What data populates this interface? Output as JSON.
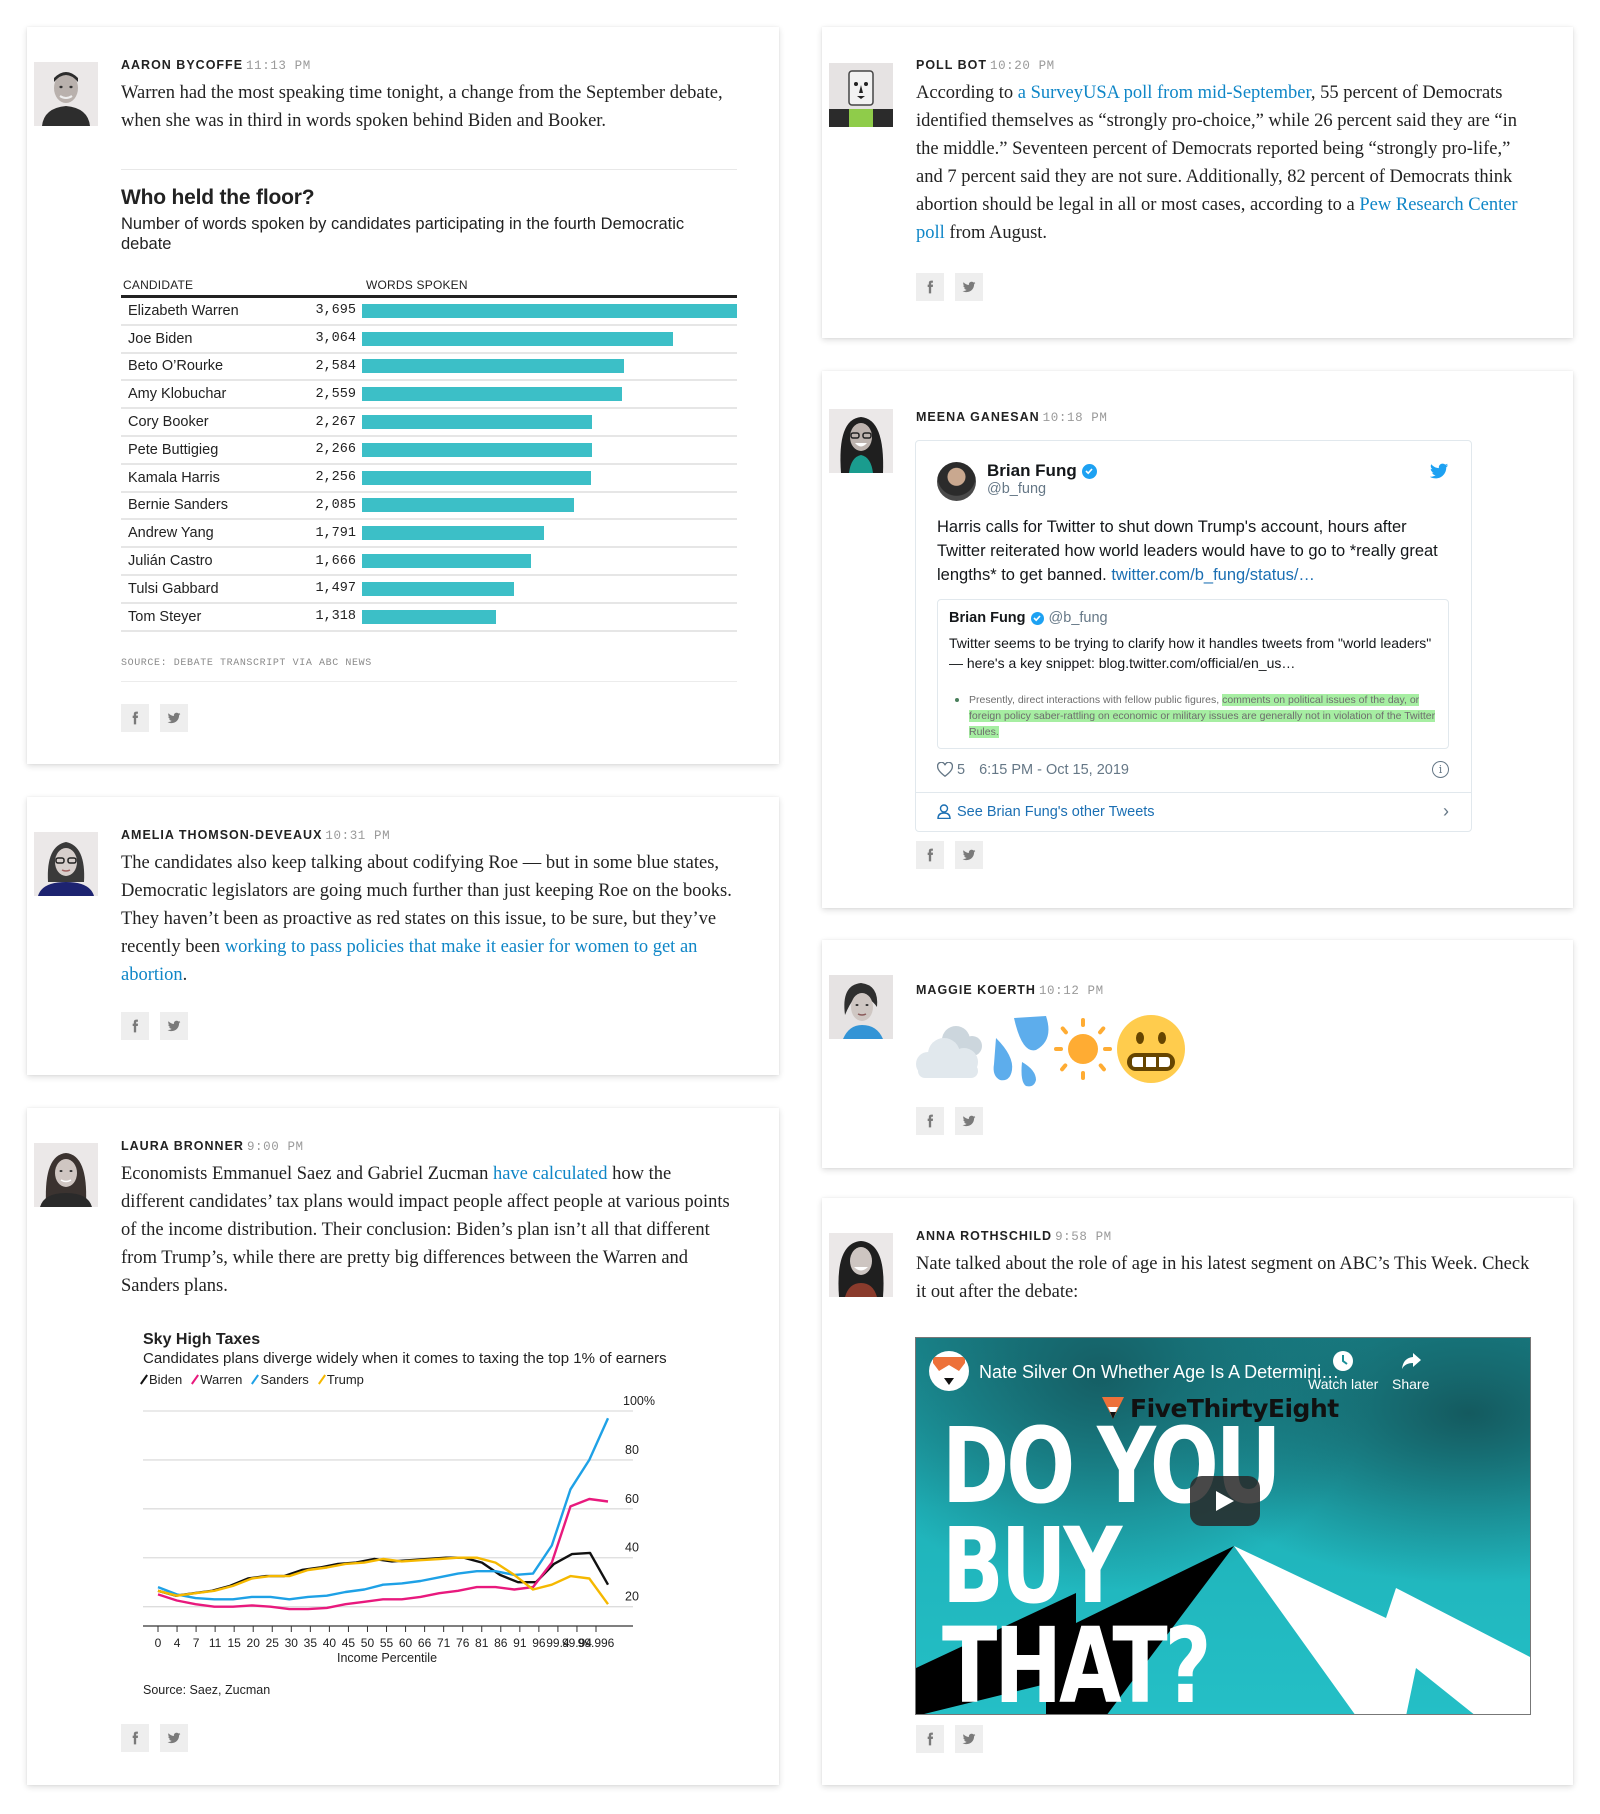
{
  "colors": {
    "link": "#0f86c7",
    "bar": "#3cbfc7",
    "biden": "#111111",
    "warren": "#e8197d",
    "sanders": "#1ea1e6",
    "trump": "#f5b800",
    "tweet_blue": "#1da1f2",
    "highlight": "#a6eea2"
  },
  "left_column": {
    "post1": {
      "author": "AARON BYCOFFE",
      "time": "11:13 PM",
      "avatar": "avatar-aaron-bycoffe",
      "body": "Warren had the most speaking time tonight, a change from the September debate, when she was in third in words spoken behind Biden and Booker.",
      "share": {
        "facebook": "facebook-icon",
        "twitter": "twitter-icon"
      }
    },
    "post2": {
      "author": "AMELIA THOMSON-DEVEAUX",
      "time": "10:31 PM",
      "avatar": "avatar-amelia-thomson-deveaux",
      "body_before": "The candidates also keep talking about codifying Roe — but in some blue states, Democratic legislators are going much further than just keeping Roe on the books. They haven’t been as proactive as red states on this issue, to be sure, but they’ve recently been ",
      "link": "working to pass policies that make it easier for women to get an abortion",
      "body_after": "."
    },
    "post3": {
      "author": "LAURA BRONNER",
      "time": "9:00 PM",
      "avatar": "avatar-laura-bronner",
      "body_before": "Economists Emmanuel Saez and Gabriel Zucman ",
      "link": "have calculated",
      "body_after": " how the different candidates’ tax plans would impact people affect people at various points of the income distribution. Their conclusion: Biden’s plan isn’t all that different from Trump’s, while there are pretty big differences between the Warren and Sanders plans."
    }
  },
  "right_column": {
    "post1": {
      "author": "POLL BOT",
      "time": "10:20 PM",
      "avatar": "avatar-poll-bot",
      "body_p1": "According to ",
      "link1": "a SurveyUSA poll from mid-September",
      "body_p2": ", 55 percent of Democrats identified themselves as “strongly pro-choice,” while 26 percent said they are “in the middle.” Seventeen percent of Democrats reported being “strongly pro-life,” and 7 percent said they are not sure. Additionally, 82 percent of Democrats think abortion should be legal in all or most cases, according to a ",
      "link2": "Pew Research Center poll",
      "body_p3": " from August."
    },
    "post2": {
      "author": "MEENA GANESAN",
      "time": "10:18 PM",
      "avatar": "avatar-meena-ganesan",
      "tweet": {
        "name": "Brian Fung",
        "handle": "@b_fung",
        "text": "Harris calls for Twitter to shut down Trump's account, hours after Twitter reiterated how world leaders would have to go to *really great lengths* to get banned. ",
        "link": "twitter.com/b_fung/status/…",
        "quote": {
          "name": "Brian Fung",
          "handle": "@b_fung",
          "text": "Twitter seems to be trying to clarify how it handles tweets from \"world leaders\" — here's a key snippet: blog.twitter.com/official/en_us…",
          "snippet_plain": "Presently, direct interactions with fellow public figures, ",
          "snippet_highlight": "comments on political issues of the day, or foreign policy saber-rattling on economic or military issues are generally not in violation of the Twitter Rules."
        },
        "likes": "5",
        "timestamp": "6:15 PM - Oct 15, 2019",
        "see_more": "See Brian Fung's other Tweets"
      }
    },
    "post3": {
      "author": "MAGGIE KOERTH",
      "time": "10:12 PM",
      "avatar": "avatar-maggie-koerth",
      "emojis": [
        "cloud-emoji",
        "sweat-droplets-emoji",
        "sun-emoji",
        "grimacing-face-emoji"
      ]
    },
    "post4": {
      "author": "ANNA ROTHSCHILD",
      "time": "9:58 PM",
      "avatar": "avatar-anna-rothschild",
      "body": "Nate talked about the role of age in his latest segment on ABC’s This Week. Check it out after the debate:",
      "video": {
        "title": "Nate Silver On Whether Age Is A Determini…",
        "watch_later": "Watch later",
        "share": "Share",
        "brand": "FiveThirtyEight",
        "headline_line1": "DO YOU",
        "headline_line2": "BUY THAT?"
      }
    }
  },
  "chart_data": [
    {
      "type": "bar",
      "title": "Who held the floor?",
      "subtitle": "Number of words spoken by candidates participating in the fourth Democratic debate",
      "column_headers": [
        "CANDIDATE",
        "WORDS SPOKEN"
      ],
      "categories": [
        "Elizabeth Warren",
        "Joe Biden",
        "Beto O’Rourke",
        "Amy Klobuchar",
        "Cory Booker",
        "Pete Buttigieg",
        "Kamala Harris",
        "Bernie Sanders",
        "Andrew Yang",
        "Julián Castro",
        "Tulsi Gabbard",
        "Tom Steyer"
      ],
      "values": [
        3695,
        3064,
        2584,
        2559,
        2267,
        2266,
        2256,
        2085,
        1791,
        1666,
        1497,
        1318
      ],
      "value_labels": [
        "3,695",
        "3,064",
        "2,584",
        "2,559",
        "2,267",
        "2,266",
        "2,256",
        "2,085",
        "1,791",
        "1,666",
        "1,497",
        "1,318"
      ],
      "xlim": [
        0,
        3695
      ],
      "source": "SOURCE: DEBATE TRANSCRIPT VIA ABC NEWS"
    },
    {
      "type": "line",
      "title": "Sky High Taxes",
      "subtitle": "Candidates plans diverge widely when it comes to taxing the top 1% of earners",
      "xlabel": "Income Percentile",
      "ylabel": "",
      "ylim": [
        17,
        100
      ],
      "y_ticks": [
        20,
        40,
        60,
        80,
        100
      ],
      "y_tick_labels": [
        "20",
        "40",
        "60",
        "80",
        "100%"
      ],
      "x_tick_labels": [
        "0",
        "4",
        "7",
        "11",
        "15",
        "20",
        "25",
        "30",
        "35",
        "40",
        "45",
        "50",
        "55",
        "60",
        "66",
        "71",
        "76",
        "81",
        "86",
        "91",
        "96",
        "99.4",
        "99.94",
        "99.996"
      ],
      "grid": true,
      "legend": "top-left",
      "x": [
        0,
        4,
        7,
        11,
        15,
        20,
        25,
        30,
        35,
        40,
        45,
        50,
        55,
        60,
        66,
        71,
        76,
        81,
        86,
        91,
        96,
        99.4,
        99.94,
        99.996
      ],
      "series": [
        {
          "name": "Biden",
          "values": [
            26.5,
            24.5,
            25.5,
            26.5,
            28.5,
            31.5,
            32.5,
            32.5,
            35,
            36,
            37.5,
            38,
            39.5,
            38.5,
            39,
            39.5,
            40,
            40,
            38,
            33,
            30,
            30,
            37.5,
            41.5,
            42,
            29
          ]
        },
        {
          "name": "Warren",
          "values": [
            25,
            22.5,
            21,
            20,
            20,
            20.5,
            20,
            19,
            19,
            19.5,
            21,
            22,
            23,
            23,
            24,
            25.5,
            26.5,
            28,
            28,
            27,
            28,
            38,
            61,
            64,
            63
          ]
        },
        {
          "name": "Sanders",
          "values": [
            28,
            25,
            23.5,
            23,
            23,
            24,
            24,
            23,
            24,
            24.5,
            26,
            27,
            29,
            29.5,
            30.5,
            32,
            33.5,
            34.5,
            34.5,
            33,
            33.5,
            45,
            68,
            80,
            97
          ]
        },
        {
          "name": "Trump",
          "values": [
            26.5,
            24.5,
            25.5,
            26.5,
            28.5,
            31.5,
            32.5,
            32.5,
            35,
            36,
            37.5,
            38,
            39.5,
            38.5,
            39,
            39.5,
            40,
            40,
            38,
            33,
            27,
            29,
            32.5,
            31.5,
            21
          ]
        }
      ],
      "source": "Source: Saez, Zucman"
    }
  ]
}
